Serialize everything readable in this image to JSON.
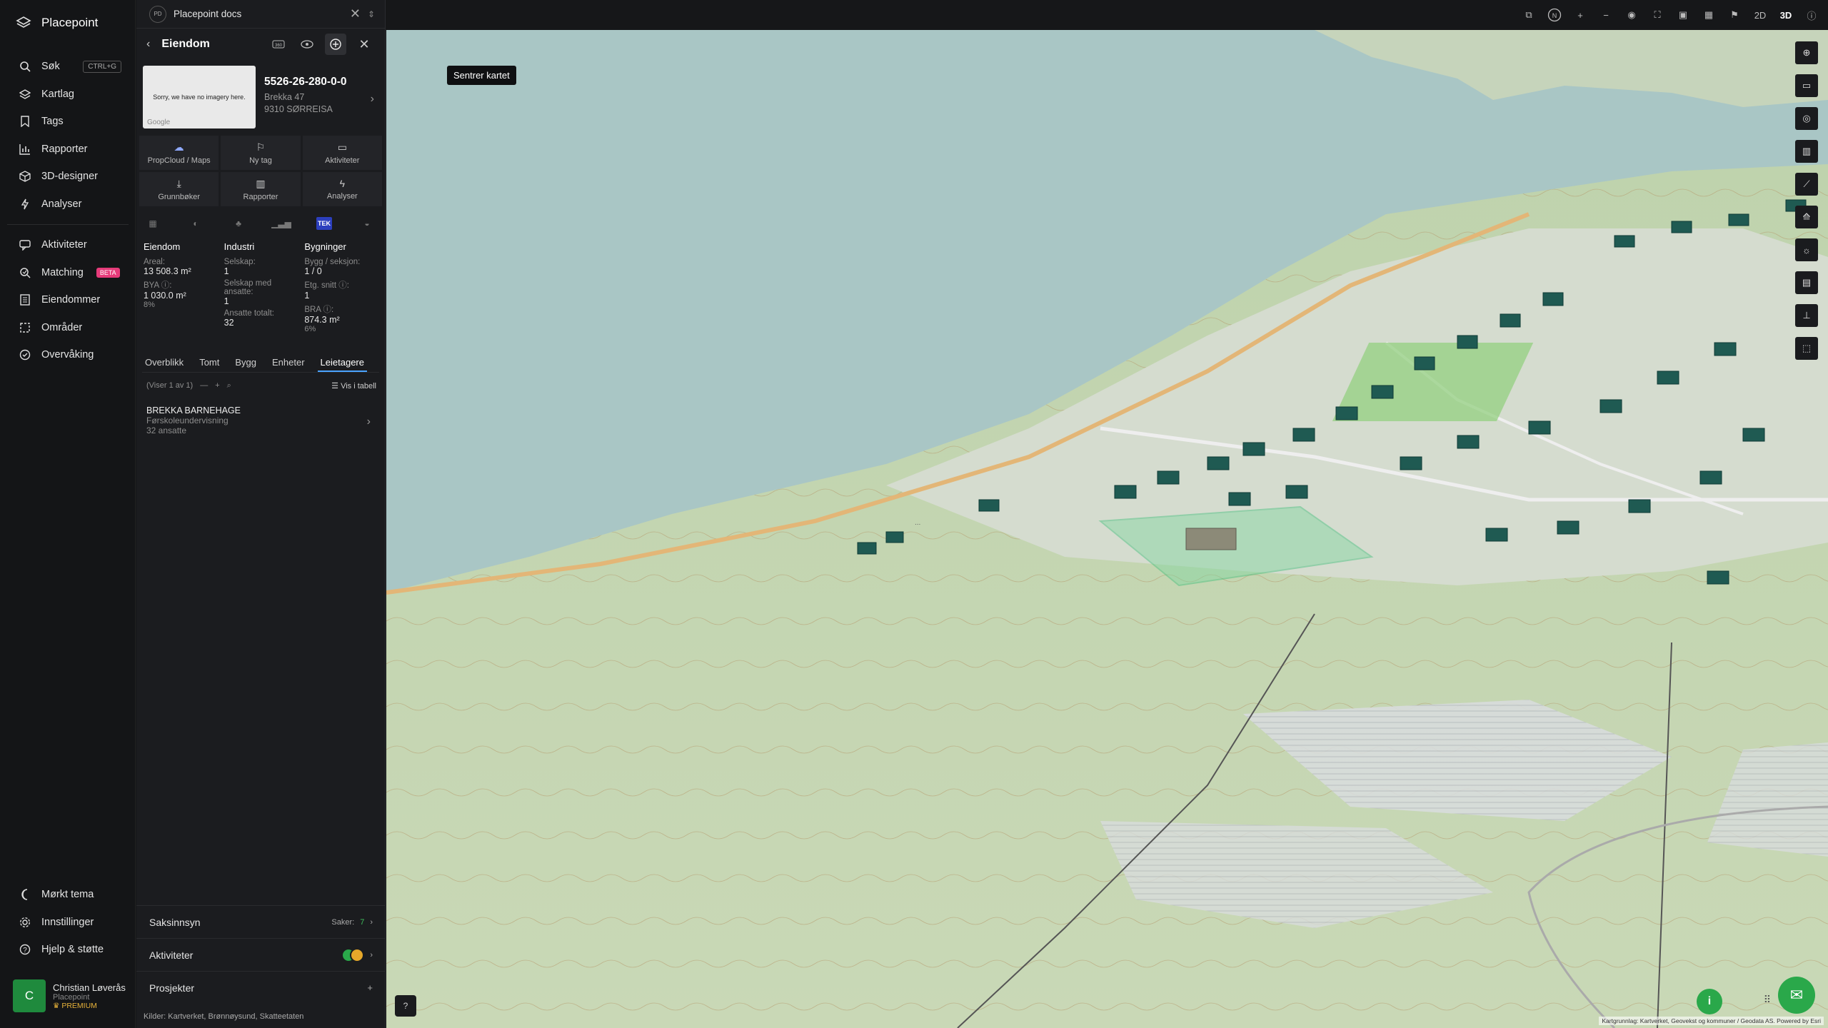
{
  "app": {
    "name": "Placepoint"
  },
  "nav": {
    "items": [
      {
        "label": "Søk",
        "icon": "search-icon",
        "shortcut": "CTRL+G"
      },
      {
        "label": "Kartlag",
        "icon": "layers-icon"
      },
      {
        "label": "Tags",
        "icon": "bookmark-icon"
      },
      {
        "label": "Rapporter",
        "icon": "chart-icon"
      },
      {
        "label": "3D-designer",
        "icon": "cube-icon"
      },
      {
        "label": "Analyser",
        "icon": "bolt-icon"
      }
    ],
    "items2": [
      {
        "label": "Aktiviteter",
        "icon": "chat-icon"
      },
      {
        "label": "Matching",
        "icon": "matching-icon",
        "badge": "BETA"
      },
      {
        "label": "Eiendommer",
        "icon": "building-icon"
      },
      {
        "label": "Områder",
        "icon": "area-icon"
      },
      {
        "label": "Overvåking",
        "icon": "monitor-icon"
      }
    ],
    "bottom": [
      {
        "label": "Mørkt tema",
        "icon": "moon-icon"
      },
      {
        "label": "Innstillinger",
        "icon": "gear-icon"
      },
      {
        "label": "Hjelp & støtte",
        "icon": "help-icon"
      }
    ],
    "user": {
      "initial": "C",
      "name": "Christian Løverås",
      "org": "Placepoint",
      "plan": "PREMIUM"
    }
  },
  "panel": {
    "doc_title": "Placepoint docs",
    "doc_logo": "PD",
    "header": "Eiendom",
    "tooltip": "Sentrer kartet",
    "street_image_text": "Sorry, we have no imagery here.",
    "street_image_brand": "Google",
    "property_id": "5526-26-280-0-0",
    "address_line1": "Brekka 47",
    "address_line2": "9310 SØRREISA",
    "actions": [
      {
        "label": "PropCloud / Maps",
        "icon": "cloud-icon"
      },
      {
        "label": "Ny tag",
        "icon": "tag-icon"
      },
      {
        "label": "Aktiviteter",
        "icon": "chat-icon"
      },
      {
        "label": "Grunnbøker",
        "icon": "download-icon"
      },
      {
        "label": "Rapporter",
        "icon": "chart-icon"
      },
      {
        "label": "Analyser",
        "icon": "bolt-icon"
      }
    ],
    "tek_label": "TEK",
    "stats": {
      "eiendom": {
        "title": "Eiendom",
        "areal_label": "Areal:",
        "areal": "13 508.3",
        "areal_unit": "m²",
        "bya_label": "BYA ⓘ:",
        "bya": "1 030.0",
        "bya_unit": "m²",
        "bya_pct": "8%"
      },
      "industri": {
        "title": "Industri",
        "selskap_label": "Selskap:",
        "selskap": "1",
        "ansatte_label": "Selskap med ansatte:",
        "ansatte": "1",
        "totalt_label": "Ansatte totalt:",
        "totalt": "32"
      },
      "bygninger": {
        "title": "Bygninger",
        "seksjon_label": "Bygg / seksjon:",
        "seksjon": "1 / 0",
        "etg_label": "Etg. snitt ⓘ:",
        "etg": "1",
        "bra_label": "BRA ⓘ:",
        "bra": "874.3",
        "bra_unit": "m²",
        "bra_pct": "6%"
      }
    },
    "tabs": [
      "Overblikk",
      "Tomt",
      "Bygg",
      "Enheter",
      "Leietagere"
    ],
    "active_tab": "Leietagere",
    "list_count": "(Viser 1 av 1)",
    "list_view": "Vis i tabell",
    "tenant": {
      "name": "BREKKA BARNEHAGE",
      "type": "Førskoleundervisning",
      "employees": "32 ansatte"
    },
    "sections": {
      "saksinnsyn": "Saksinnsyn",
      "saker_label": "Saker:",
      "saker": "7",
      "aktiviteter": "Aktiviteter",
      "prosjekter": "Prosjekter"
    },
    "sources": {
      "label": "Kilder:",
      "items": [
        "Kartverket,",
        "Brønnøysund,",
        "Skatteetaten"
      ]
    }
  },
  "map": {
    "mode_2d": "2D",
    "mode_3d": "3D",
    "active_mode": "3D",
    "compass": "N",
    "attribution": "Kartgrunnlag: Kartverket, Geovekst og kommuner / Geodata AS. Powered by Esri"
  }
}
